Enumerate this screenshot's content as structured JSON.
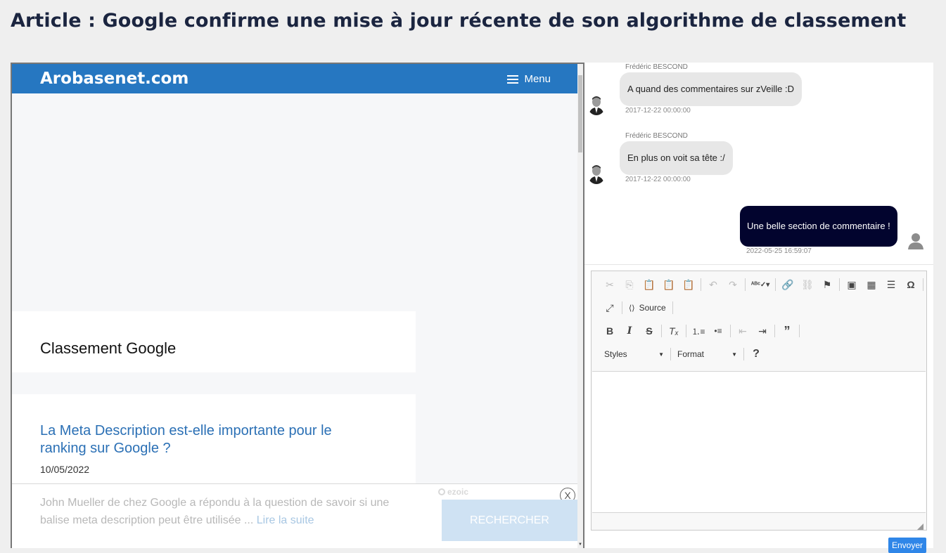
{
  "page": {
    "title": "Article : Google confirme une mise à jour récente de son algorithme de classement"
  },
  "site": {
    "brand": "Arobasenet.com",
    "menu_label": "Menu",
    "category_title": "Classement Google",
    "article": {
      "title": "La Meta Description est-elle importante pour le ranking sur Google ?",
      "date": "10/05/2022",
      "excerpt": "John Mueller de chez Google a répondu à la question de savoir si une balise meta description peut être utilisée ...",
      "read_more": "Lire la suite"
    },
    "ad": {
      "provider": "ezoic",
      "close_label": "X",
      "button_label": "RECHERCHER"
    }
  },
  "comments": [
    {
      "author": "Frédéric BESCOND",
      "text": "A quand des commentaires sur zVeille :D",
      "timestamp": "2017-12-22 00:00:00"
    },
    {
      "author": "Frédéric BESCOND",
      "text": "En plus on voit sa tête :/",
      "timestamp": "2017-12-22 00:00:00"
    },
    {
      "text": "Une belle section de commentaire !",
      "timestamp": "2022-05-25 16:59:07"
    }
  ],
  "editor": {
    "source_label": "Source",
    "styles_label": "Styles",
    "format_label": "Format",
    "help_label": "?",
    "send_label": "Envoyer"
  },
  "colors": {
    "site_header": "#2677c1",
    "own_bubble": "#02042e",
    "send_button": "#2f86e8"
  }
}
